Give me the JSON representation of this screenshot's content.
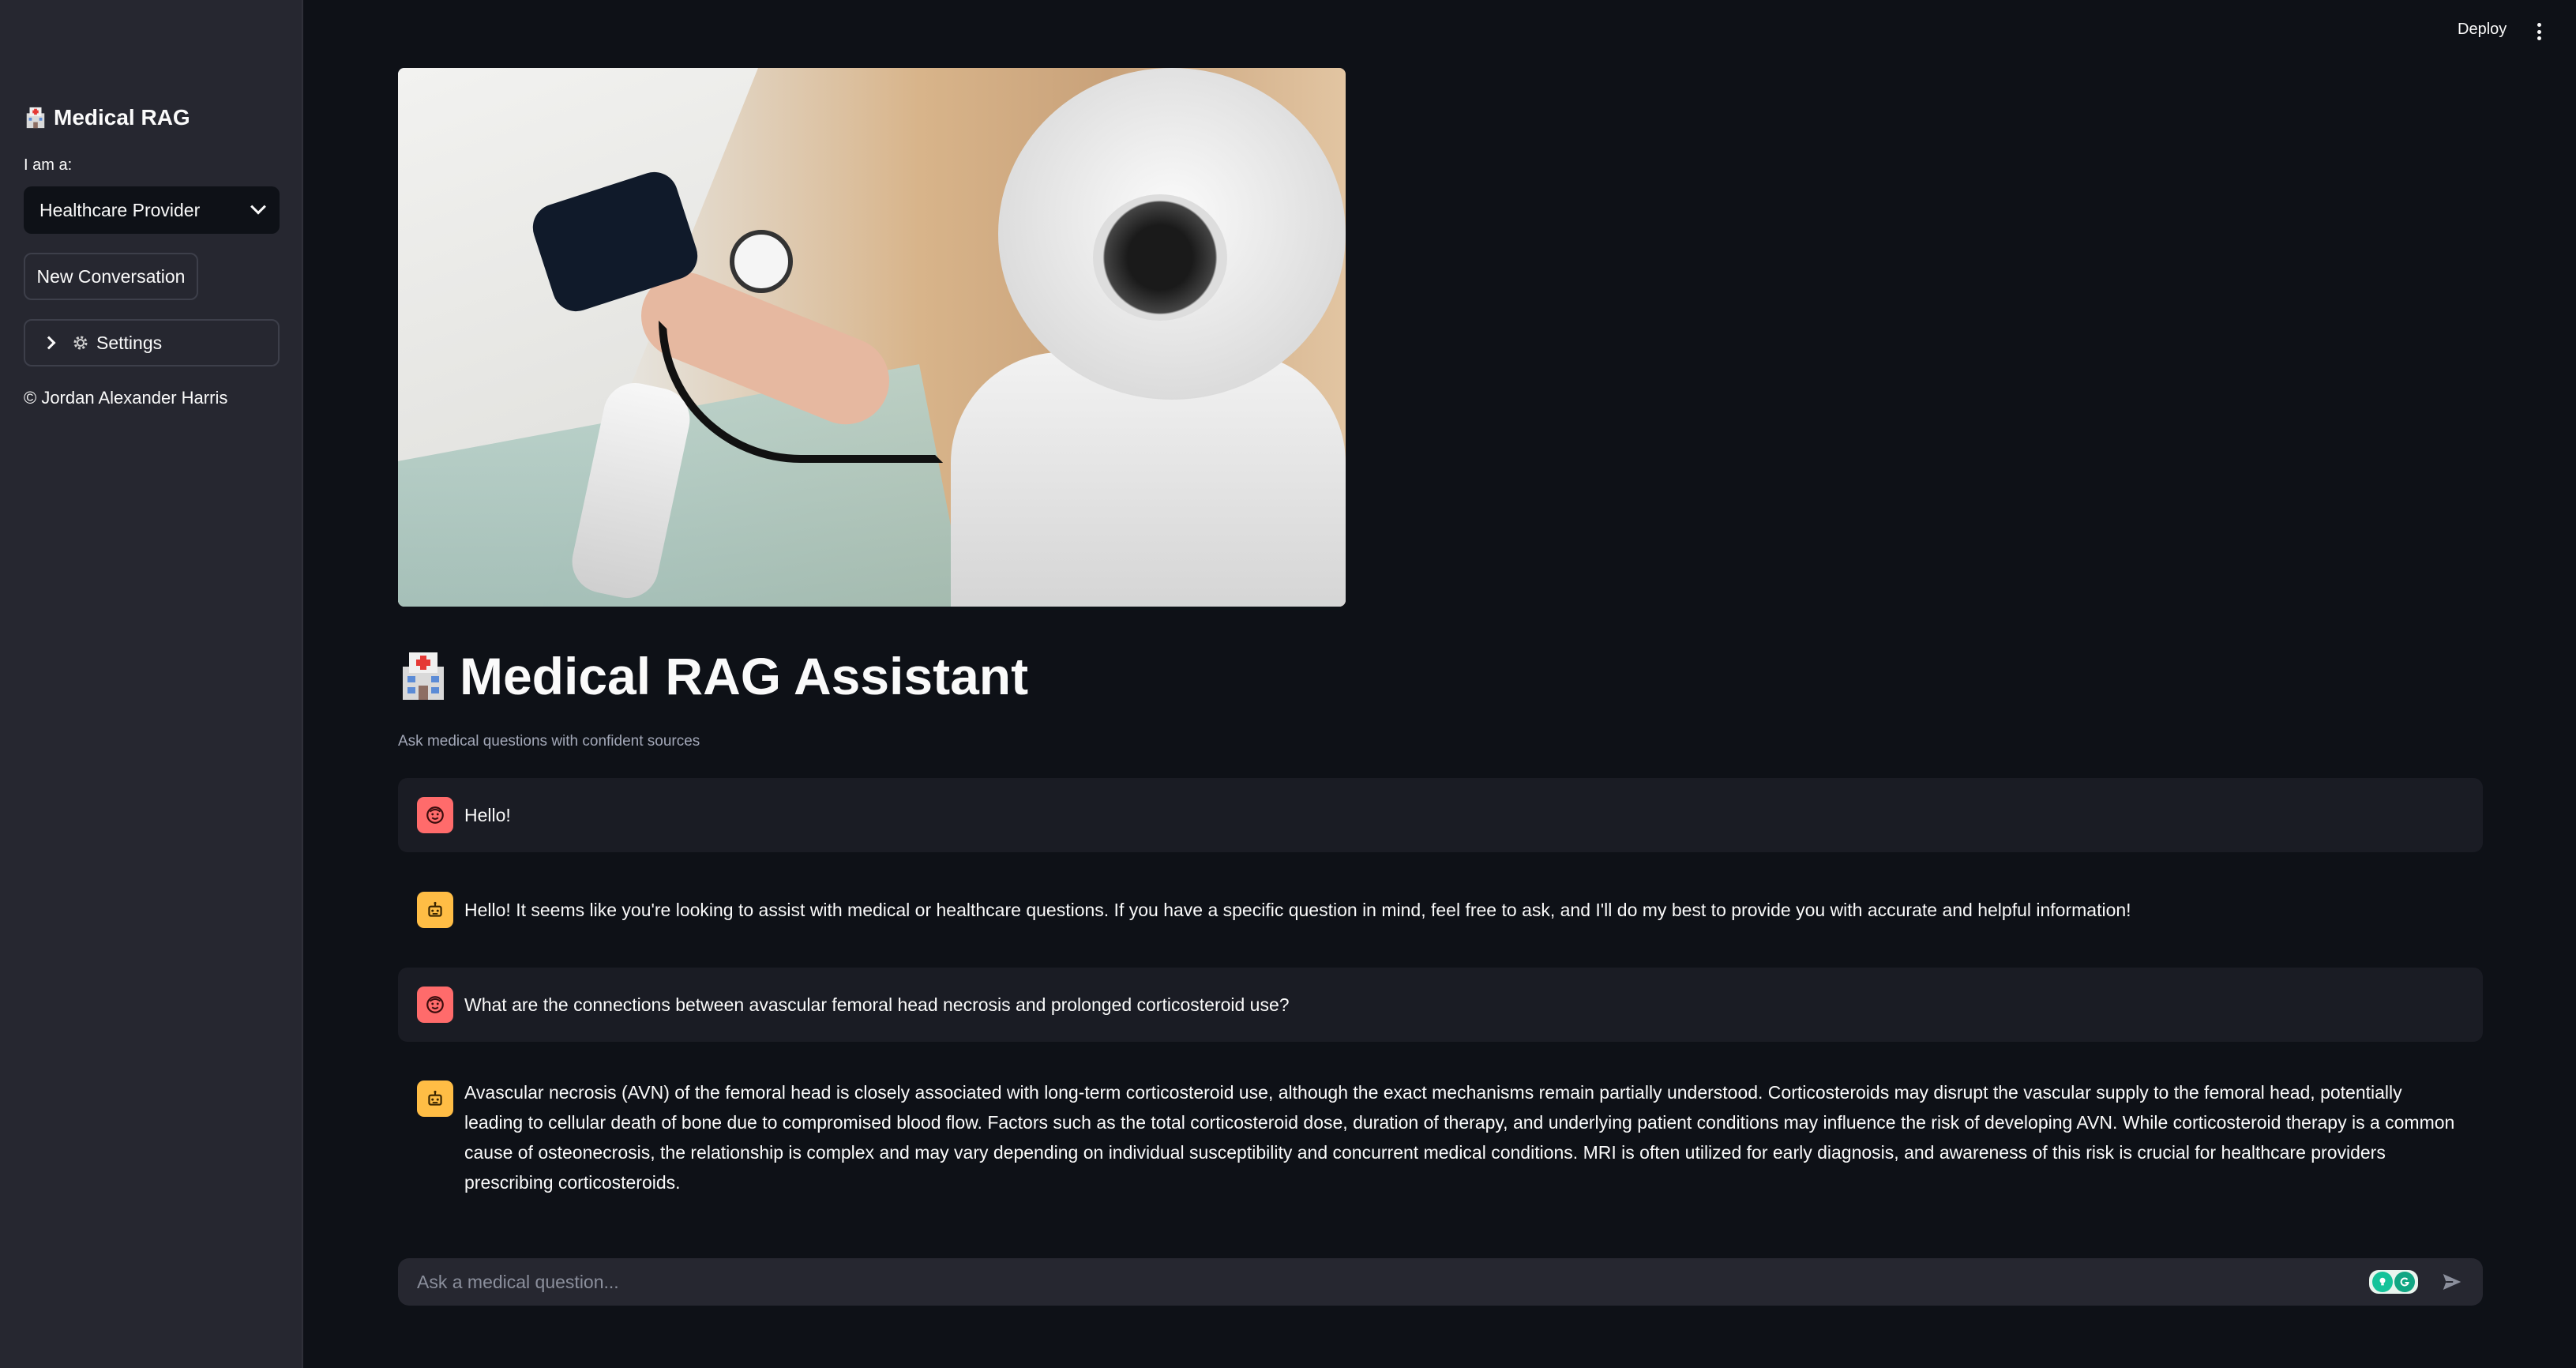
{
  "topbar": {
    "deploy_label": "Deploy"
  },
  "sidebar": {
    "title": "Medical RAG",
    "role_label": "I am a:",
    "role_selected": "Healthcare Provider",
    "new_conversation_label": "New Conversation",
    "settings_label": "Settings",
    "copyright": "© Jordan Alexander Harris"
  },
  "main": {
    "title": "Medical RAG Assistant",
    "subtitle": "Ask medical questions with confident sources",
    "messages": [
      {
        "role": "user",
        "text": "Hello!"
      },
      {
        "role": "assistant",
        "text": "Hello! It seems like you're looking to assist with medical or healthcare questions. If you have a specific question in mind, feel free to ask, and I'll do my best to provide you with accurate and helpful information!"
      },
      {
        "role": "user",
        "text": "What are the connections between avascular femoral head necrosis and prolonged corticosteroid use?"
      },
      {
        "role": "assistant",
        "text": "Avascular necrosis (AVN) of the femoral head is closely associated with long-term corticosteroid use, although the exact mechanisms remain partially understood. Corticosteroids may disrupt the vascular supply to the femoral head, potentially leading to cellular death of bone due to compromised blood flow. Factors such as the total corticosteroid dose, duration of therapy, and underlying patient conditions may influence the risk of developing AVN. While corticosteroid therapy is a common cause of osteonecrosis, the relationship is complex and may vary depending on individual susceptibility and concurrent medical conditions. MRI is often utilized for early diagnosis, and awareness of this risk is crucial for healthcare providers prescribing corticosteroids."
      }
    ],
    "chat_input": {
      "placeholder": "Ask a medical question..."
    }
  },
  "colors": {
    "background": "#0e1117",
    "sidebar": "#262730",
    "user_avatar": "#ff6b6b",
    "assistant_avatar": "#ffbd45",
    "user_message_bg": "#1a1c24"
  },
  "icons": {
    "title_icon": "hospital-icon",
    "user_avatar": "face-icon",
    "assistant_avatar": "robot-icon",
    "settings": "gear-icon",
    "send": "send-icon"
  }
}
